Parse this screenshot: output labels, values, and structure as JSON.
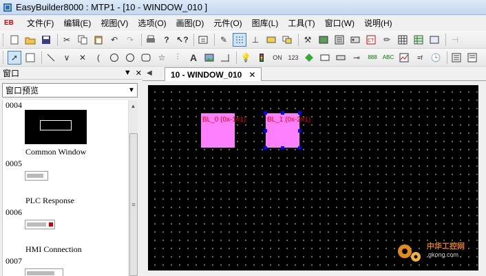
{
  "window": {
    "title": "EasyBuilder8000 : MTP1 - [10 - WINDOW_010 ]",
    "app_icon": "easybuilder-icon"
  },
  "menubar": {
    "logo": "EB",
    "items": [
      "文件(F)",
      "编辑(E)",
      "视图(V)",
      "选项(O)",
      "画图(D)",
      "元件(O)",
      "图库(L)",
      "工具(T)",
      "窗口(W)",
      "说明(H)"
    ]
  },
  "toolbar1": {
    "icons": [
      "new-icon",
      "open-icon",
      "save-icon",
      "cut-icon",
      "copy-icon",
      "paste-icon",
      "undo-icon",
      "redo-icon",
      "print-icon",
      "help-icon",
      "context-help-icon",
      "compile-icon",
      "pen-icon",
      "grid-icon",
      "align-icon",
      "rectangle-icon",
      "layer-icon",
      "tools-icon",
      "object-icon",
      "screen-icon",
      "component-icon",
      "plc-icon",
      "edit-icon",
      "table-icon",
      "database-icon",
      "scroll-icon",
      "more-icon"
    ]
  },
  "toolbar2": {
    "icons": [
      "select-icon",
      "pointer-icon",
      "line-icon",
      "polyline-icon",
      "close-line-icon",
      "arc-icon",
      "circle-icon",
      "rounded-rect-icon",
      "shape-icon",
      "star-icon",
      "scale-icon",
      "text-icon",
      "image-icon",
      "rect-fill-icon",
      "bulb-icon",
      "traffic-light-icon",
      "toggle-icon",
      "numeric-icon",
      "diamond-icon",
      "ascii-icon",
      "keyboard-icon",
      "slider-icon",
      "display-icon",
      "setpoint-icon",
      "trend-icon",
      "function-icon",
      "clock-icon",
      "alarm-icon",
      "event-icon"
    ]
  },
  "left_panel": {
    "title": "窗口",
    "controls": [
      "▼",
      "✕"
    ],
    "dropdown": "窗口预览",
    "windows": [
      {
        "number": "0004",
        "label": "Common Window"
      },
      {
        "number": "0005",
        "label": "PLC Response"
      },
      {
        "number": "0006",
        "label": "HMI Connection"
      },
      {
        "number": "0007",
        "label": ""
      }
    ]
  },
  "tabs": {
    "scroll_left": "◀",
    "active": "10 - WINDOW_010",
    "close": "✕"
  },
  "canvas": {
    "objects": [
      {
        "label": "BL_0 (0x-1#1)",
        "selected": false
      },
      {
        "label": "BL_1 (0x-2#1)",
        "selected": true
      }
    ],
    "object_color": "#ff80ff",
    "label_color": "#ee0000",
    "handle_color": "#0000ff"
  },
  "watermark": {
    "text": "中华工控网",
    "sub": "gkong.com"
  }
}
